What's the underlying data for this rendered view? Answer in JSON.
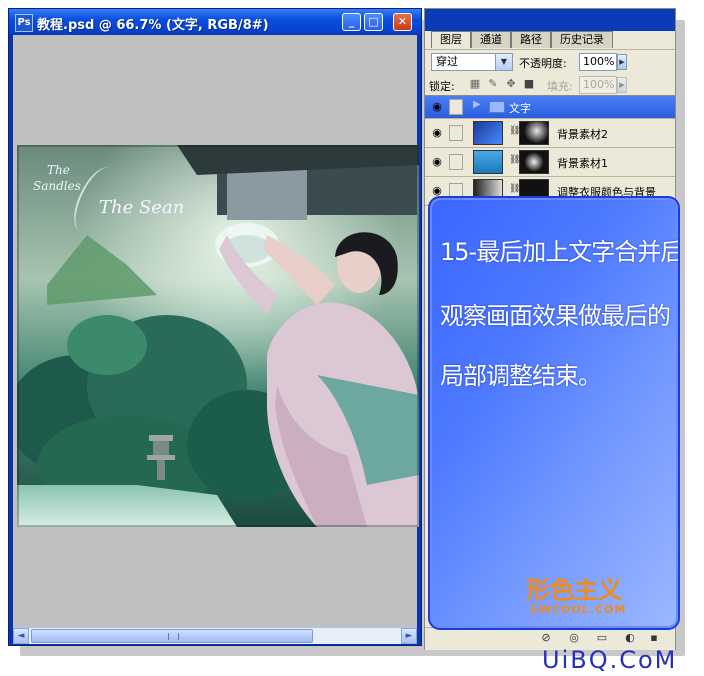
{
  "document": {
    "title": "教程.psd @ 66.7% (文字, RGB/8#)",
    "icon_label": "Ps",
    "buttons": {
      "minimize": "_",
      "maximize": "□",
      "close": "✕"
    },
    "photo_text": {
      "line1": "The",
      "line2": "Sandles",
      "script": "The Sean"
    },
    "scrollbar": {
      "left_arrow": "◄",
      "right_arrow": "►",
      "grip": "|||"
    }
  },
  "layers_panel": {
    "tabs": [
      "图层",
      "通道",
      "路径",
      "历史记录"
    ],
    "blend_mode": "穿过",
    "opacity_label": "不透明度:",
    "opacity_value": "100%",
    "lock_label": "锁定:",
    "fill_label": "填充:",
    "fill_value": "100%",
    "layers": [
      {
        "name": "文字",
        "type": "group",
        "selected": true
      },
      {
        "name": "背景素材2",
        "type": "layer",
        "selected": false
      },
      {
        "name": "背景素材1",
        "type": "layer",
        "selected": false
      },
      {
        "name": "调整衣服颜色与背景",
        "type": "layer",
        "selected": false
      }
    ]
  },
  "callout": {
    "lines": [
      "15-最后加上文字合并后",
      "观察画面效果做最后的",
      "局部调整结束。"
    ],
    "brand_cn": "形色主义",
    "brand_en": "SWCOOL.COM"
  },
  "watermark": "UiBQ.CoM",
  "colors": {
    "titlebar": "#0a4ee0",
    "callout": "#4e7aff",
    "brand": "#f08a1a",
    "watermark": "#2430b8"
  }
}
